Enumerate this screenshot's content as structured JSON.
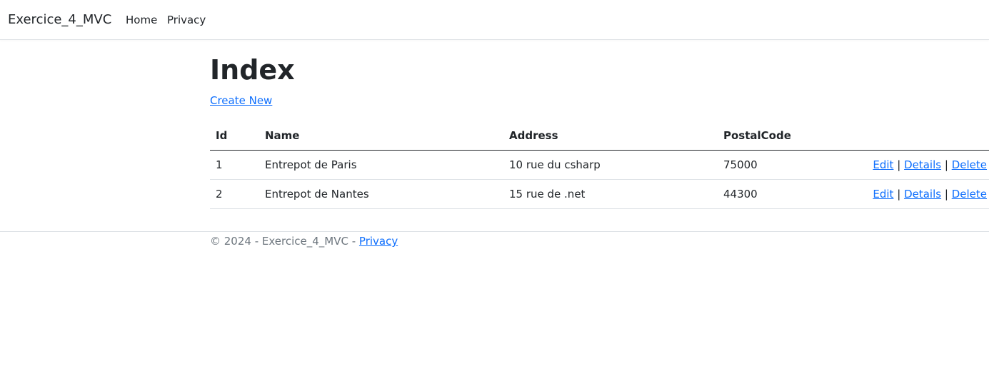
{
  "navbar": {
    "brand": "Exercice_4_MVC",
    "links": [
      "Home",
      "Privacy"
    ]
  },
  "main": {
    "title": "Index",
    "create_link": "Create New",
    "table": {
      "headers": [
        "Id",
        "Name",
        "Address",
        "PostalCode"
      ],
      "rows": [
        {
          "id": "1",
          "name": "Entrepot de Paris",
          "address": "10 rue du csharp",
          "postal_code": "75000"
        },
        {
          "id": "2",
          "name": "Entrepot de Nantes",
          "address": "15 rue de .net",
          "postal_code": "44300"
        }
      ],
      "actions": {
        "edit": "Edit",
        "details": "Details",
        "delete": "Delete",
        "separator": "|"
      }
    }
  },
  "footer": {
    "text": "© 2024 - Exercice_4_MVC - ",
    "privacy_link": "Privacy"
  },
  "colors": {
    "link": "#0d6efd",
    "text": "#212529",
    "muted": "#6c757d",
    "border": "#dee2e6"
  }
}
